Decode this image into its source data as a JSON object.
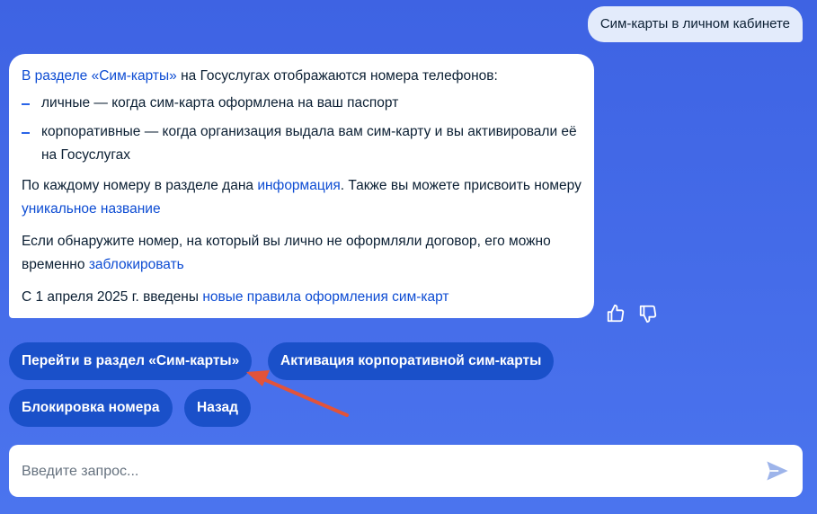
{
  "chat": {
    "user_message": "Сим-карты в личном кабинете",
    "bot": {
      "p1_link": "В разделе «Сим-карты»",
      "p1_text": " на Госуслугах отображаются номера телефонов:",
      "list": [
        "личные — когда сим-карта оформлена на ваш паспорт",
        "корпоративные — когда организация выдала вам сим-карту и вы активировали её на Госуслугах"
      ],
      "p2_text_a": "По каждому номеру в разделе дана ",
      "p2_link_a": "информация",
      "p2_text_b": ". Также вы можете присвоить номеру ",
      "p2_link_b": "уникальное название",
      "p3_text": "Если обнаружите номер, на который вы лично не оформляли договор, его можно временно ",
      "p3_link": "заблокировать",
      "p4_text": "С 1 апреля 2025 г. введены ",
      "p4_link": "новые правила оформления сим-карт"
    }
  },
  "feedback": {
    "like_icon": "thumbs-up-icon",
    "dislike_icon": "thumbs-down-icon"
  },
  "quick_replies": [
    "Перейти в раздел «Сим-карты»",
    "Активация корпоративной сим-карты",
    "Блокировка номера",
    "Назад"
  ],
  "input": {
    "placeholder": "Введите запрос...",
    "value": "",
    "send_icon": "send-icon"
  },
  "annotation": {
    "arrow_icon": "red-arrow-icon",
    "color": "#E2533A"
  },
  "colors": {
    "background": "#4169E6",
    "link": "#0D4CD3",
    "chip": "#1A50C9",
    "user_bubble": "#E3EBFB"
  }
}
